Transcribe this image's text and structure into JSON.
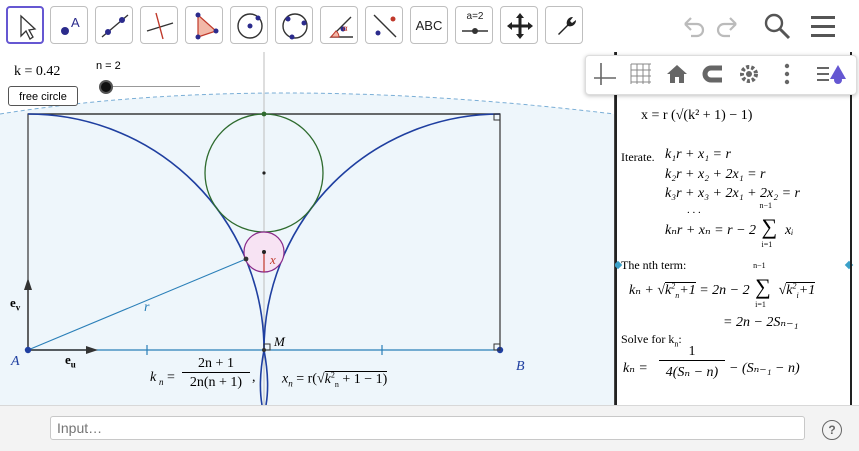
{
  "toolbar": {
    "abc_label": "ABC",
    "slider_label": "a=2",
    "icons": [
      "move-icon",
      "point-icon",
      "line-icon",
      "perpendicular-icon",
      "polygon-icon",
      "circle-center-icon",
      "circle-three-points-icon",
      "angle-icon",
      "reflect-icon",
      "text-icon",
      "slider-icon",
      "move-view-icon",
      "tools-icon"
    ],
    "right_icons": [
      "undo-icon",
      "redo-icon",
      "search-icon",
      "menu-icon"
    ]
  },
  "graphics_toolbar_icons": [
    "axes-icon",
    "grid-icon",
    "home-icon",
    "magnet-icon",
    "settings-icon",
    "more-icon",
    "style-bar-icon"
  ],
  "canvas": {
    "k_label": "k = 0.42",
    "free_circle_button": "free circle",
    "slider_n_label": "n = 2",
    "label_A": "A",
    "label_B": "B",
    "label_M": "M",
    "label_r": "r",
    "label_x": "x",
    "label_ev": "e",
    "label_ev_sub": "v",
    "label_eu": "e",
    "label_eu_sub": "u",
    "formula_kn_lhs": "k",
    "formula_kn_sub": "n",
    "formula_kn_num": "2n + 1",
    "formula_kn_den": "2n(n + 1)",
    "formula_xn_lhs": "x",
    "formula_xn_sub": "n",
    "formula_xn_rhs_a": "= r(",
    "formula_xn_rhs_b": "k",
    "formula_xn_rhs_c": "+ 1 − 1)",
    "accent_color": "#6557d2"
  },
  "algebra": {
    "top_formula": "x = r (√(k² + 1) − 1)",
    "iterate_label": "Iterate.",
    "iter_line1": "k₁r + x₁ = r",
    "iter_line2": "k₂r + x₂ + 2x₁ = r",
    "iter_line3": "k₃r + x₃ + 2x₁ + 2x₂ = r",
    "iter_dots": ". . .",
    "iter_line_n_a": "kₙr + xₙ = r − 2",
    "iter_line_n_b": "xᵢ",
    "sum_top": "n−1",
    "sum_bottom": "i=1",
    "nth_label": "The nth term:",
    "nth_line1_a": "kₙ +",
    "nth_line1_b": "= 2n − 2",
    "nth_line2": "= 2n − 2Sₙ₋₁",
    "solve_label": "Solve for k",
    "solve_label_sub": "n",
    "solve_colon": ":",
    "solve_lhs": "kₙ =",
    "solve_num": "1",
    "solve_den": "4(Sₙ − n)",
    "solve_rhs": "− (Sₙ₋₁ − n)"
  },
  "input": {
    "placeholder": "Input…",
    "help": "?"
  }
}
